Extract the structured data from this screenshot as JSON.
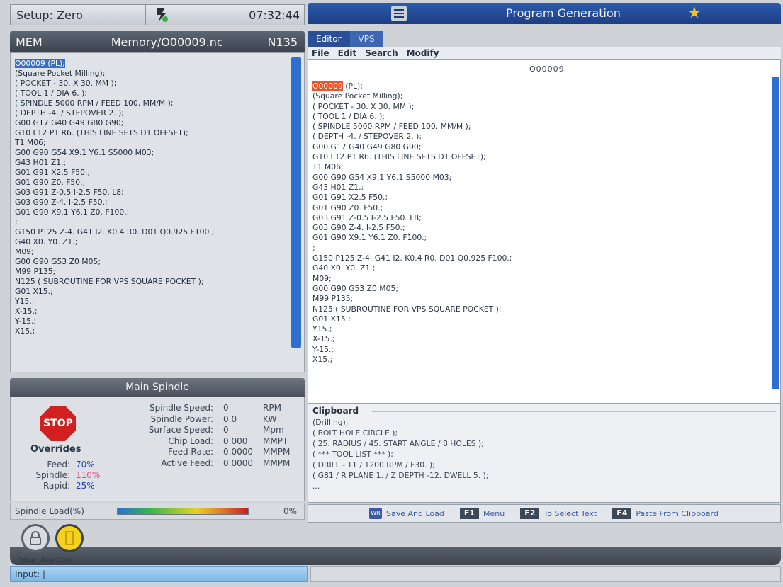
{
  "status": {
    "setup": "Setup: Zero",
    "clock": "07:32:44"
  },
  "memory": {
    "mode": "MEM",
    "path": "Memory/O00009.nc",
    "seq": "N135",
    "lines": [
      "O00009 (PL);",
      "(Square Pocket Milling);",
      "( POCKET - 30. X 30. MM );",
      "( TOOL 1 / DIA 6. );",
      "( SPINDLE 5000 RPM / FEED 100. MM/M );",
      "( DEPTH -4. / STEPOVER 2. );",
      "G00 G17 G40 G49 G80 G90;",
      "G10 L12 P1 R6. (THIS LINE SETS D1 OFFSET);",
      "T1 M06;",
      "G00 G90 G54 X9.1 Y6.1 S5000 M03;",
      "G43 H01 Z1.;",
      "G01 G91 X2.5 F50.;",
      "G01 G90 Z0. F50.;",
      "G03 G91 Z-0.5 I-2.5 F50. L8;",
      "G03 G90 Z-4. I-2.5 F50.;",
      "G01 G90 X9.1 Y6.1 Z0. F100.;",
      ";",
      "G150 P125 Z-4. G41 I2. K0.4 R0. D01 Q0.925 F100.;",
      "G40 X0. Y0. Z1.;",
      "M09;",
      "G00 G90 G53 Z0 M05;",
      "M99 P135;",
      "N125 ( SUBROUTINE FOR VPS SQUARE POCKET );",
      "G01 X15.;",
      "Y15.;",
      "X-15.;",
      "Y-15.;",
      "X15.;"
    ]
  },
  "spindle": {
    "title": "Main Spindle",
    "stop": "STOP",
    "overrides_title": "Overrides",
    "overrides": [
      {
        "label": "Feed:",
        "value": "70%",
        "color": "#1b3fbf"
      },
      {
        "label": "Spindle:",
        "value": "110%",
        "color": "#e04a8a"
      },
      {
        "label": "Rapid:",
        "value": "25%",
        "color": "#1b3fbf"
      }
    ],
    "stats": [
      {
        "label": "Spindle Speed:",
        "value": "0",
        "unit": "RPM"
      },
      {
        "label": "Spindle Power:",
        "value": "0.0",
        "unit": "KW"
      },
      {
        "label": "Surface Speed:",
        "value": "0",
        "unit": "Mpm"
      },
      {
        "label": "Chip Load:",
        "value": "0.000",
        "unit": "MMPT"
      },
      {
        "label": "Feed Rate:",
        "value": "0.0000",
        "unit": "MMPM"
      },
      {
        "label": "Active Feed:",
        "value": "0.0000",
        "unit": "MMPM"
      }
    ],
    "load_label": "Spindle Load(%)",
    "load_value": "0%"
  },
  "program": {
    "title": "Program Generation",
    "tabs": [
      "Editor",
      "VPS"
    ],
    "menu": [
      "File",
      "Edit",
      "Search",
      "Modify"
    ],
    "filename": "O00009",
    "lines": [
      "O00009",
      "(Square Pocket Milling);",
      "( POCKET - 30. X 30. MM );",
      "( TOOL 1 / DIA 6. );",
      "( SPINDLE 5000 RPM / FEED 100. MM/M );",
      "( DEPTH -4. / STEPOVER 2. );",
      "G00 G17 G40 G49 G80 G90;",
      "G10 L12 P1 R6. (THIS LINE SETS D1 OFFSET);",
      "T1 M06;",
      "G00 G90 G54 X9.1 Y6.1 S5000 M03;",
      "G43 H01 Z1.;",
      "G01 G91 X2.5 F50.;",
      "G01 G90 Z0. F50.;",
      "G03 G91 Z-0.5 I-2.5 F50. L8;",
      "G03 G90 Z-4. I-2.5 F50.;",
      "G01 G90 X9.1 Y6.1 Z0. F100.;",
      ";",
      "G150 P125 Z-4. G41 I2. K0.4 R0. D01 Q0.925 F100.;",
      "G40 X0. Y0. Z1.;",
      "M09;",
      "G00 G90 G53 Z0 M05;",
      "M99 P135;",
      "N125 ( SUBROUTINE FOR VPS SQUARE POCKET );",
      "G01 X15.;",
      "Y15.;",
      "X-15.;",
      "Y-15.;",
      "X15.;"
    ],
    "first_line_suffix": " (PL);"
  },
  "clipboard": {
    "title": "Clipboard",
    "lines": [
      "(Drilling);",
      "( BOLT HOLE CIRCLE );",
      "( 25. RADIUS / 45. START ANGLE / 8 HOLES );",
      "( *** TOOL LIST *** );",
      "( DRILL - T1 / 1200 RPM / F30. );",
      "( G81 / R PLANE 1. / Z DEPTH -12. DWELL 5. );",
      "..."
    ]
  },
  "bottom_bar": {
    "wr_key": "WR",
    "save_load": "Save And Load",
    "f1": "F1",
    "f1_label": "Menu",
    "f2": "F2",
    "f2_label": "To Select Text",
    "f4": "F4",
    "f4_label": "Paste From Clipboard"
  },
  "footer": {
    "setup_label": "Setup",
    "door_label": "Door Open",
    "input_label": "Input:"
  }
}
